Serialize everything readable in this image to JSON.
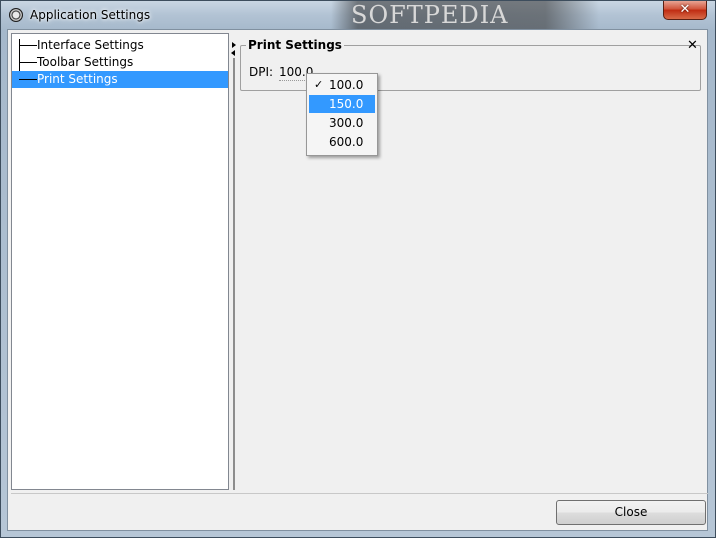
{
  "window": {
    "title": "Application Settings",
    "banner_text": "SOFTPEDIA",
    "close_glyph": "✕"
  },
  "tree": {
    "items": [
      {
        "label": "Interface Settings",
        "selected": false
      },
      {
        "label": "Toolbar Settings",
        "selected": false
      },
      {
        "label": "Print Settings",
        "selected": true
      }
    ]
  },
  "panel": {
    "title": "Print Settings",
    "close_glyph": "✕",
    "dpi_label": "DPI:",
    "dpi_value": "100.0"
  },
  "dropdown": {
    "options": [
      {
        "label": "100.0",
        "checked": true,
        "highlighted": false
      },
      {
        "label": "150.0",
        "checked": false,
        "highlighted": true
      },
      {
        "label": "300.0",
        "checked": false,
        "highlighted": false
      },
      {
        "label": "600.0",
        "checked": false,
        "highlighted": false
      }
    ],
    "check_glyph": "✓"
  },
  "footer": {
    "close_label": "Close"
  },
  "colors": {
    "selection": "#3399ff",
    "client_bg": "#f0f0f0",
    "close_red": "#c02c12"
  }
}
